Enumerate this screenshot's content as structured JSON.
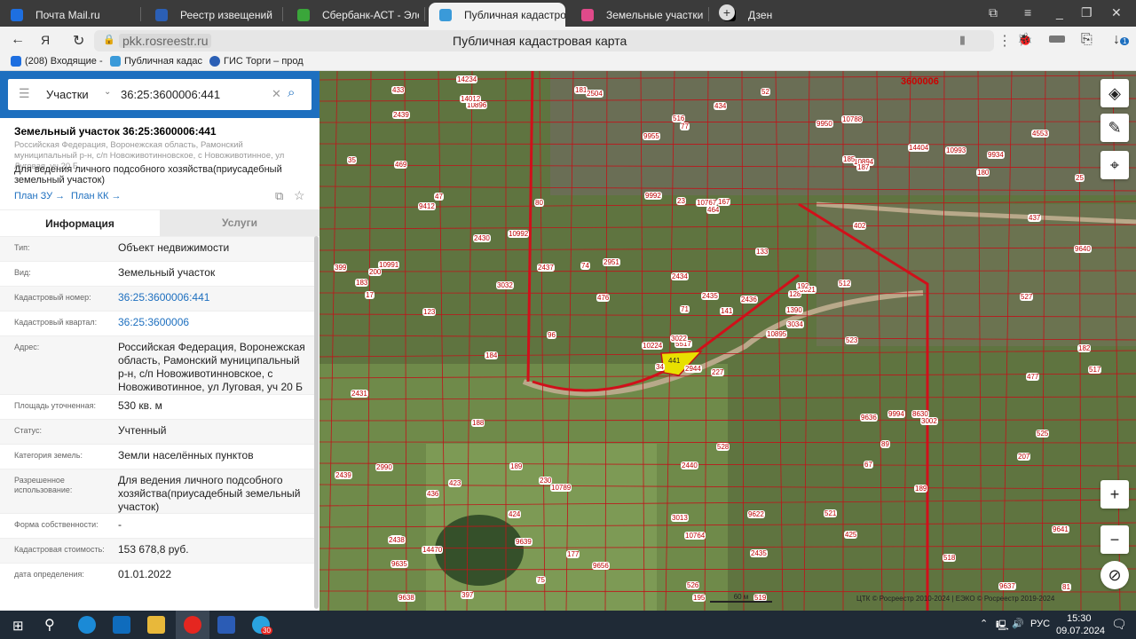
{
  "browser": {
    "tabs": [
      {
        "label": "Почта Mail.ru",
        "color": "#1e6fe0"
      },
      {
        "label": "Реестр извещений",
        "color": "#2b5fb5"
      },
      {
        "label": "Сбербанк-АСТ - Электрон",
        "color": "#3aa63a"
      },
      {
        "label": "Публичная кадастрова",
        "color": "#3a9ad9",
        "active": true
      },
      {
        "label": "Земельные участки в Нов",
        "color": "#e04a8a"
      },
      {
        "label": "Дзен",
        "color": "#000000"
      }
    ],
    "url": "pkk.rosreestr.ru",
    "page_title": "Публичная кадастровая карта",
    "download_badge": "1",
    "bookmarks": [
      "(208) Входящие -",
      "Публичная кадас",
      "ГИС Торги – прод"
    ]
  },
  "search": {
    "type": "Участки",
    "value": "36:25:3600006:441"
  },
  "parcel": {
    "title": "Земельный участок 36:25:3600006:441",
    "address_short": "Российская Федерация, Воронежская область, Рамонский муниципальный р-н, с/п Новоживотинновское, с Новоживотинное, ул Луговая, уч 20 Б",
    "purpose": "Для ведения личного подсобного хозяйства(приусадебный земельный участок)",
    "link_plan_zu": "План ЗУ →",
    "link_plan_kk": "План КК →"
  },
  "tabs": {
    "info": "Информация",
    "services": "Услуги"
  },
  "info_rows": [
    {
      "label": "Тип:",
      "value": "Объект недвижимости"
    },
    {
      "label": "Вид:",
      "value": "Земельный участок"
    },
    {
      "label": "Кадастровый номер:",
      "value": "36:25:3600006:441",
      "link": true
    },
    {
      "label": "Кадастровый квартал:",
      "value": "36:25:3600006",
      "link": true
    },
    {
      "label": "Адрес:",
      "value": "Российская Федерация, Воронежская область, Рамонский муниципальный р-н, с/п Новоживотинновское, с Новоживотинное, ул Луговая, уч 20 Б"
    },
    {
      "label": "Площадь уточненная:",
      "value": "530 кв. м"
    },
    {
      "label": "Статус:",
      "value": "Учтенный"
    },
    {
      "label": "Категория земель:",
      "value": "Земли населённых пунктов"
    },
    {
      "label": "Разрешенное использование:",
      "value": "Для ведения личного подсобного хозяйства(приусадебный земельный участок)"
    },
    {
      "label": "Форма собственности:",
      "value": "-"
    },
    {
      "label": "Кадастровая стоимость:",
      "value": "153 678,8 руб."
    },
    {
      "label": "дата определения:",
      "value": "01.01.2022"
    }
  ],
  "map": {
    "quarter_label": "3600006",
    "selected_parcel": "441",
    "labels": [
      "227",
      "9412",
      "5517",
      "263",
      "128",
      "10789",
      "10788",
      "167",
      "10894",
      "10895",
      "10896",
      "81",
      "123",
      "25",
      "34",
      "402",
      "397",
      "23",
      "133",
      "423",
      "2951",
      "9635",
      "9639",
      "10767",
      "3021",
      "3002",
      "47",
      "77",
      "17",
      "9636",
      "9640",
      "3022",
      "3013",
      "71",
      "80",
      "14404",
      "230",
      "9637",
      "9641",
      "8630",
      "52",
      "74",
      "3032",
      "67",
      "75",
      "399",
      "1390",
      "9638",
      "10764",
      "3034",
      "436",
      "437",
      "35",
      "89",
      "425",
      "424",
      "14012",
      "433",
      "9622",
      "9934",
      "434",
      "96",
      "10991",
      "10992",
      "10993",
      "14234",
      "9950",
      "9955",
      "2435",
      "2439",
      "2440",
      "9656",
      "9994",
      "2437",
      "2438",
      "2439",
      "2430",
      "2431",
      "2434",
      "2435",
      "2436",
      "14470",
      "523",
      "525",
      "526",
      "527",
      "528",
      "518",
      "519",
      "521",
      "516",
      "517",
      "512",
      "189",
      "141",
      "207",
      "200",
      "195",
      "185",
      "187",
      "184",
      "181",
      "182",
      "183",
      "188",
      "189",
      "177",
      "192",
      "180",
      "476",
      "477",
      "469",
      "464",
      "10224",
      "2504",
      "2990",
      "2944",
      "4553",
      "9992"
    ],
    "scale": "60 м",
    "attribution": "ЦТК © Росреестр 2010-2024 | ЕЭКО © Росреестр 2019-2024"
  },
  "taskbar": {
    "lang": "РУС",
    "time": "15:30",
    "date": "09.07.2024",
    "telegram_badge": "30"
  }
}
